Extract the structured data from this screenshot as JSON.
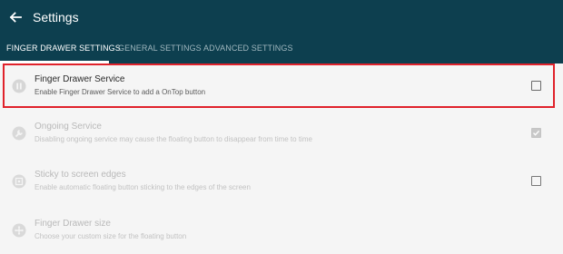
{
  "header": {
    "title": "Settings",
    "back_icon": "arrow-back-icon",
    "background_color": "#0d3f4f"
  },
  "tabs": [
    {
      "label": "FINGER DRAWER SETTINGS",
      "active": true
    },
    {
      "label": "GENERAL SETTINGS",
      "active": false
    },
    {
      "label": "ADVANCED SETTINGS",
      "active": false
    }
  ],
  "settings": [
    {
      "icon": "pause-circle-icon",
      "label": "Finger Drawer Service",
      "description": "Enable Finger Drawer Service to add a OnTop button",
      "checked": false,
      "enabled": true
    },
    {
      "icon": "wrench-icon",
      "label": "Ongoing Service",
      "description": "Disabling ongoing service may cause the floating button to disappear from time to time",
      "checked": true,
      "enabled": false
    },
    {
      "icon": "screen-edges-icon",
      "label": "Sticky to screen edges",
      "description": "Enable automatic floating button sticking to the edges of the screen",
      "checked": false,
      "enabled": false
    },
    {
      "icon": "move-icon",
      "label": "Finger Drawer size",
      "description": "Choose your custom size for the floating button",
      "enabled": false
    }
  ],
  "highlight_color": "#e0222b"
}
